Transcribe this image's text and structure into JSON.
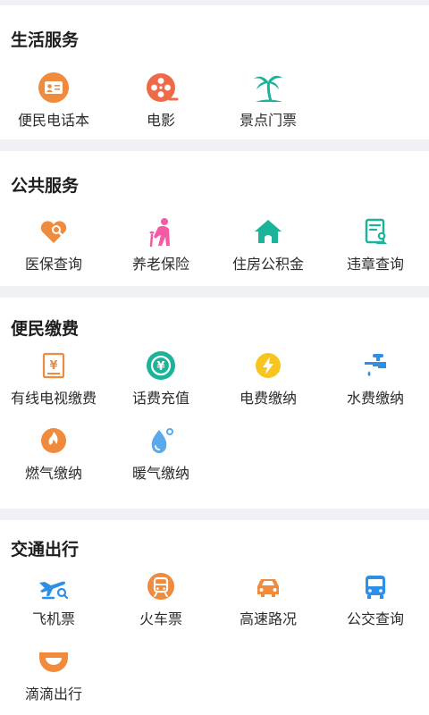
{
  "sections": [
    {
      "title": "生活服务",
      "items": [
        {
          "label": "便民电话本",
          "icon": "phonebook-icon"
        },
        {
          "label": "电影",
          "icon": "film-reel-icon"
        },
        {
          "label": "景点门票",
          "icon": "palm-tree-icon"
        }
      ]
    },
    {
      "title": "公共服务",
      "items": [
        {
          "label": "医保查询",
          "icon": "heart-search-icon"
        },
        {
          "label": "养老保险",
          "icon": "elderly-person-icon"
        },
        {
          "label": "住房公积金",
          "icon": "house-icon"
        },
        {
          "label": "违章查询",
          "icon": "document-user-icon"
        }
      ]
    },
    {
      "title": "便民缴费",
      "items": [
        {
          "label": "有线电视缴费",
          "icon": "yen-receipt-icon"
        },
        {
          "label": "话费充值",
          "icon": "yen-recharge-icon"
        },
        {
          "label": "电费缴纳",
          "icon": "lightning-icon"
        },
        {
          "label": "水费缴纳",
          "icon": "water-tap-icon"
        },
        {
          "label": "燃气缴纳",
          "icon": "gas-flame-icon"
        },
        {
          "label": "暖气缴纳",
          "icon": "heating-drop-icon"
        }
      ]
    },
    {
      "title": "交通出行",
      "items": [
        {
          "label": "飞机票",
          "icon": "airplane-search-icon"
        },
        {
          "label": "火车票",
          "icon": "train-icon"
        },
        {
          "label": "高速路况",
          "icon": "car-icon"
        },
        {
          "label": "公交查询",
          "icon": "bus-icon"
        },
        {
          "label": "滴滴出行",
          "icon": "didi-icon"
        }
      ]
    }
  ],
  "colors": {
    "orange": "#f08a3c",
    "coral": "#f06a4a",
    "teal": "#1bb39a",
    "pink": "#f45aa6",
    "blue": "#2d8fe6",
    "yellow": "#f7c51d",
    "light_blue": "#5aa9ec"
  }
}
